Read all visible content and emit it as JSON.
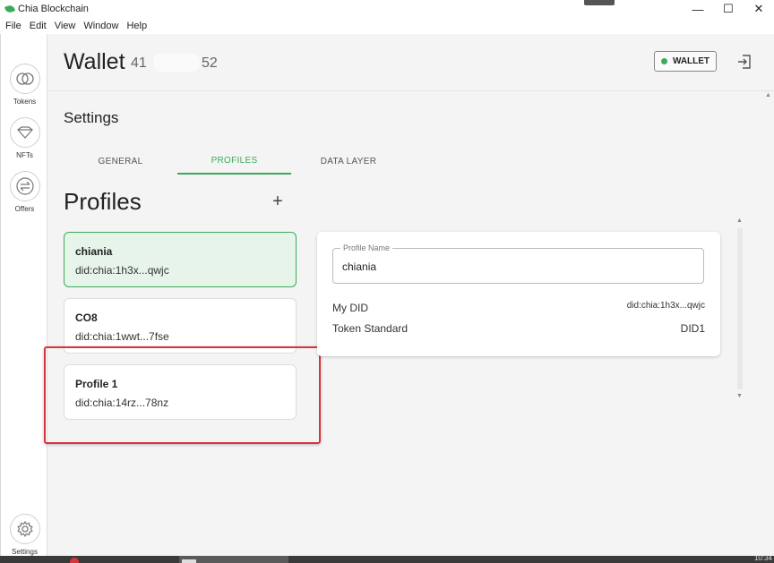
{
  "window": {
    "title": "Chia Blockchain",
    "controls": [
      "—",
      "☐",
      "✕"
    ]
  },
  "menu": [
    "File",
    "Edit",
    "View",
    "Window",
    "Help"
  ],
  "sidebar": {
    "items": [
      {
        "label": "Tokens",
        "icon": "tokens-icon"
      },
      {
        "label": "NFTs",
        "icon": "nft-diamond-icon"
      },
      {
        "label": "Offers",
        "icon": "offers-swap-icon"
      },
      {
        "label": "Settings",
        "icon": "gear-icon"
      }
    ]
  },
  "header": {
    "title": "Wallet",
    "id_prefix": "41",
    "id_suffix": "52",
    "wallet_button": "WALLET",
    "status_color": "#3aac59"
  },
  "settings": {
    "title": "Settings",
    "tabs": [
      {
        "label": "GENERAL",
        "active": false
      },
      {
        "label": "PROFILES",
        "active": true
      },
      {
        "label": "DATA LAYER",
        "active": false
      }
    ]
  },
  "profiles": {
    "title": "Profiles",
    "add_symbol": "+",
    "list": [
      {
        "name": "chiania",
        "did": "did:chia:1h3x...qwjc",
        "selected": true
      },
      {
        "name": "CO8",
        "did": "did:chia:1wwt...7fse",
        "selected": false
      },
      {
        "name": "Profile 1",
        "did": "did:chia:14rz...78nz",
        "selected": false
      }
    ]
  },
  "detail": {
    "profile_name_label": "Profile Name",
    "profile_name_value": "chiania",
    "my_did_label": "My DID",
    "my_did_value": "did:chia:1h3x...qwjc",
    "token_standard_label": "Token Standard",
    "token_standard_value": "DID1"
  },
  "taskbar": {
    "clock": "10:34"
  },
  "colors": {
    "accent": "#3aac59",
    "highlight": "#d9333f"
  }
}
